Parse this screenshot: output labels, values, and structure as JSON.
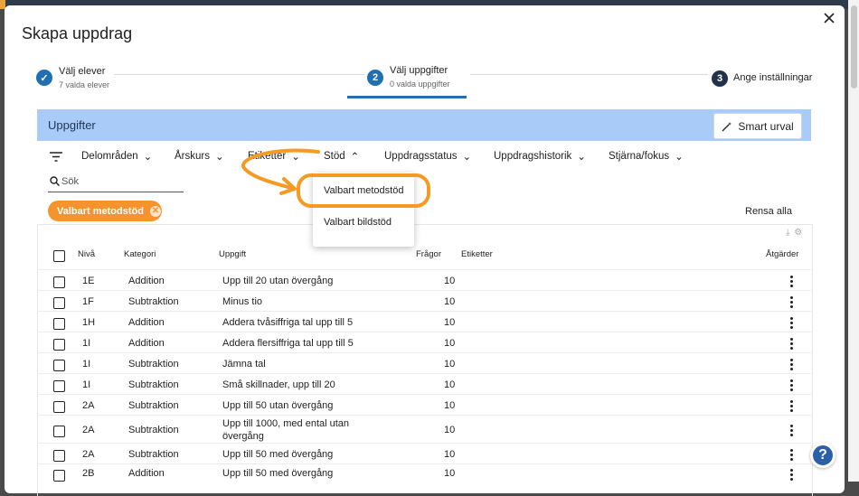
{
  "dialog": {
    "title": "Skapa uppdrag"
  },
  "steps": [
    {
      "label": "Välj elever",
      "sub": "7 valda elever",
      "badge": "✓"
    },
    {
      "label": "Välj uppgifter",
      "sub": "0 valda uppgifter",
      "badge": "2"
    },
    {
      "label": "Ange inställningar",
      "badge": "3"
    }
  ],
  "panel": {
    "title": "Uppgifter",
    "smart_label": "Smart urval"
  },
  "filters": [
    "Delområden",
    "Årskurs",
    "Etiketter",
    "Stöd",
    "Uppdragsstatus",
    "Uppdragshistorik",
    "Stjärna/fokus"
  ],
  "search": {
    "placeholder": "Sök"
  },
  "active_chip": "Valbart metodstöd",
  "clear_all": "Rensa alla",
  "dropdown": {
    "items": [
      "Valbart metodstöd",
      "Valbart bildstöd"
    ]
  },
  "table": {
    "headers": {
      "level": "Nivå",
      "category": "Kategori",
      "task": "Uppgift",
      "questions": "Frågor",
      "tags": "Etiketter",
      "actions": "Åtgärder"
    },
    "rows": [
      {
        "level": "1E",
        "category": "Addition",
        "task": "Upp till 20 utan övergång",
        "questions": "10"
      },
      {
        "level": "1F",
        "category": "Subtraktion",
        "task": "Minus tio",
        "questions": "10"
      },
      {
        "level": "1H",
        "category": "Addition",
        "task": "Addera tvåsiffriga tal upp till 5",
        "questions": "10"
      },
      {
        "level": "1I",
        "category": "Addition",
        "task": "Addera flersiffriga tal upp till 5",
        "questions": "10"
      },
      {
        "level": "1I",
        "category": "Subtraktion",
        "task": "Jämna tal",
        "questions": "10"
      },
      {
        "level": "1I",
        "category": "Subtraktion",
        "task": "Små skillnader, upp till 20",
        "questions": "10"
      },
      {
        "level": "2A",
        "category": "Subtraktion",
        "task": "Upp till 50 utan övergång",
        "questions": "10"
      },
      {
        "level": "2A",
        "category": "Subtraktion",
        "task": "Upp till 1000, med ental utan",
        "task2": "övergång",
        "questions": "10"
      },
      {
        "level": "2A",
        "category": "Subtraktion",
        "task": "Upp till 50 med övergång",
        "questions": "10"
      },
      {
        "level": "2B",
        "category": "Addition",
        "task": "Upp till 50 med övergång",
        "questions": "10"
      }
    ]
  },
  "help": {
    "label": "?"
  },
  "colors": {
    "accent": "#1f6fb2",
    "toolbar": "#a9cbf7",
    "chip": "#f5932d",
    "annotation": "#f59a23"
  }
}
